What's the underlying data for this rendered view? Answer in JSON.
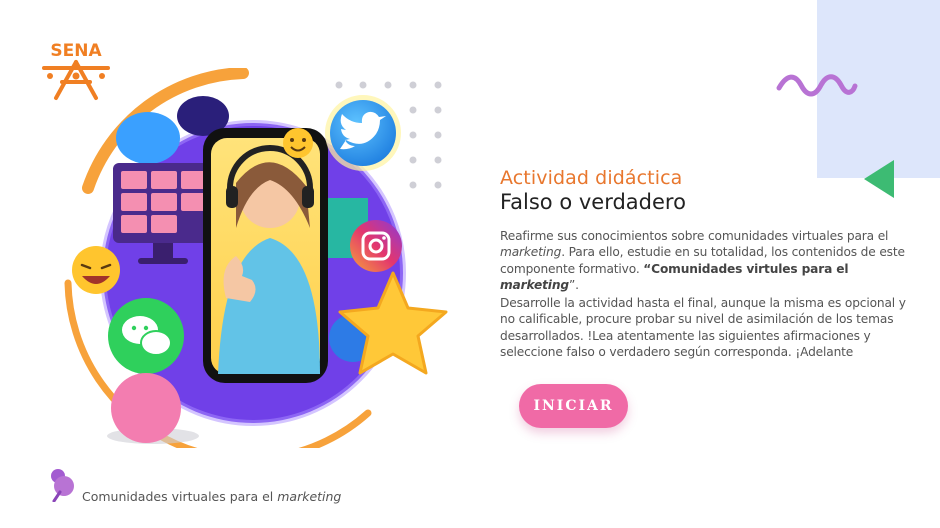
{
  "brand": {
    "logo_text": "SENA"
  },
  "activity": {
    "subtitle": "Actividad didáctica",
    "title": "Falso o verdadero",
    "p1_a": "Reafirme sus conocimientos sobre comunidades virtuales para el",
    "p1_b": "marketing",
    "p1_c": ". Para ello, estudie en su totalidad, los contenidos de este componente formativo.",
    "p1_d": "“Comunidades virtules para el",
    "p1_e": "marketing",
    "p1_f": "”.",
    "p2": "Desarrolle la actividad hasta el final, aunque la misma es opcional y no calificable, procure probar su nivel de asimilación de los temas desarrollados. !Lea atentamente las siguientes afirmaciones y seleccione falso o verdadero según corresponda. ¡Adelante",
    "start_label": "INICIAR"
  },
  "footer": {
    "text": "Comunidades virtuales para el",
    "text_italic": "marketing"
  },
  "colors": {
    "accent_orange": "#e8772e",
    "button_pink": "#f06aa6",
    "panel_blue": "#dde6fb",
    "triangle_green": "#3dbb73",
    "squiggle_purple": "#b873d4",
    "illustration_purple": "#7040e8"
  },
  "icons": [
    "sena-logo",
    "twitter-icon",
    "instagram-icon",
    "chat-icon",
    "emoji-icon",
    "star-icon",
    "pin-icon"
  ]
}
